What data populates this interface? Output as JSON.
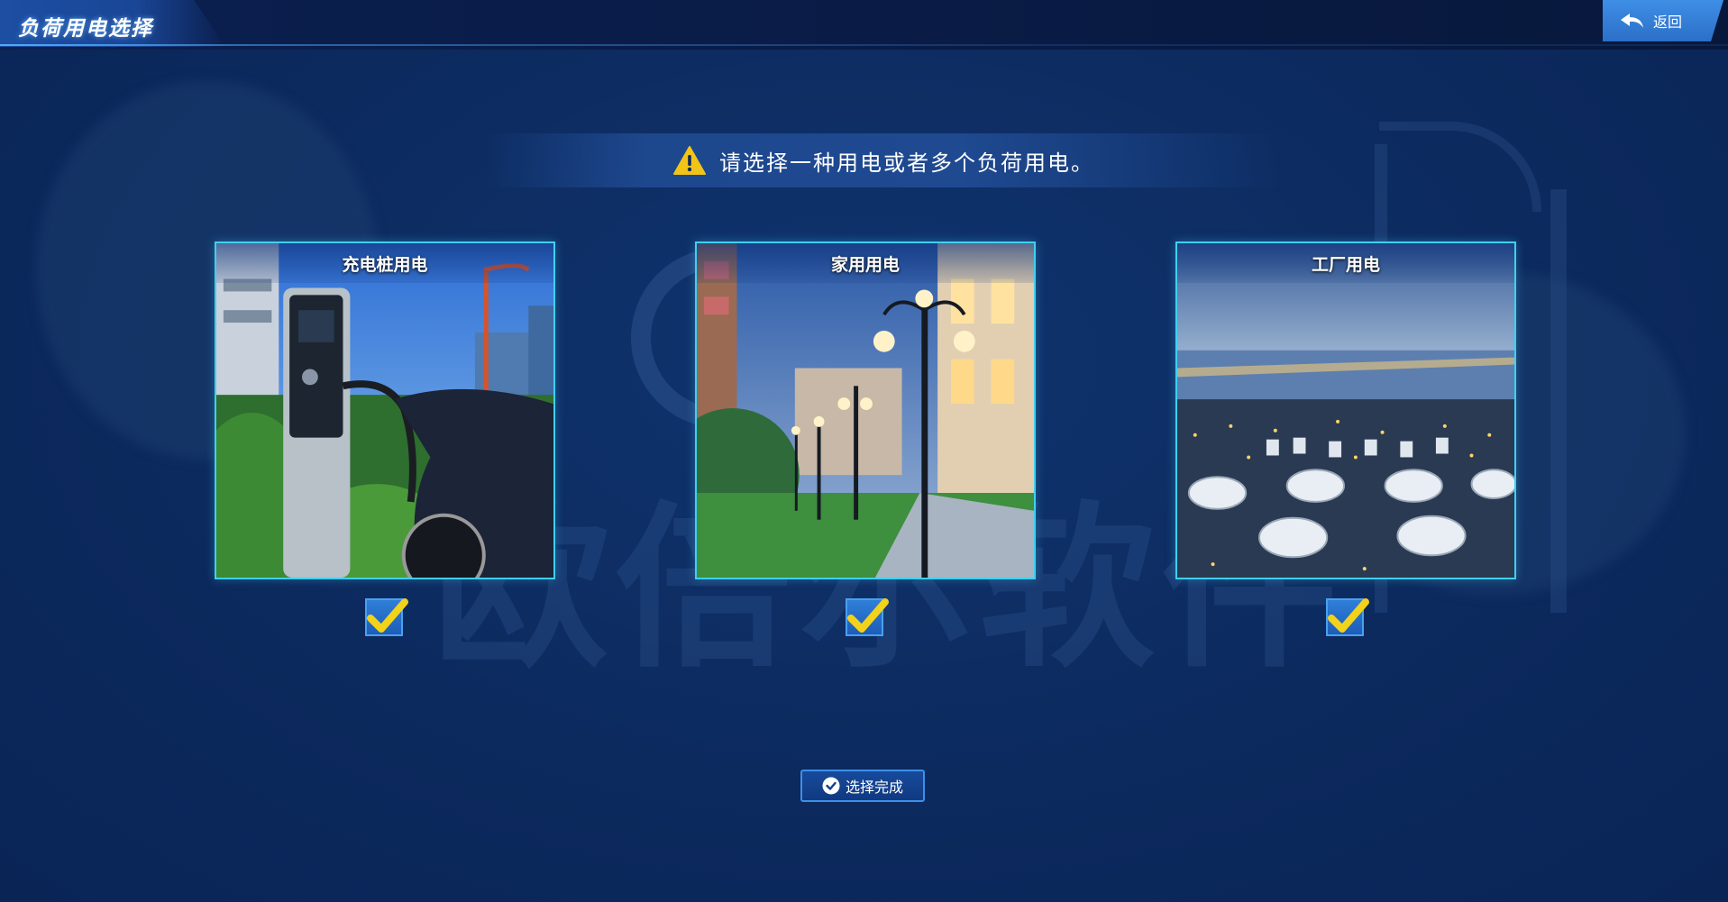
{
  "header": {
    "title": "负荷用电选择",
    "back_label": "返回"
  },
  "notice": {
    "text": "请选择一种用电或者多个负荷用电。"
  },
  "options": [
    {
      "label": "充电桩用电",
      "checked": true
    },
    {
      "label": "家用用电",
      "checked": true
    },
    {
      "label": "工厂用电",
      "checked": true
    }
  ],
  "footer": {
    "done_label": "选择完成"
  },
  "colors": {
    "background": "#0c2a5e",
    "card_border": "#3fd0f0",
    "check_mark": "#f2d21a",
    "button_border": "#3d8fe8"
  },
  "icons": [
    "back-arrow-icon",
    "warning-icon",
    "checkmark-icon",
    "check-circle-icon"
  ]
}
